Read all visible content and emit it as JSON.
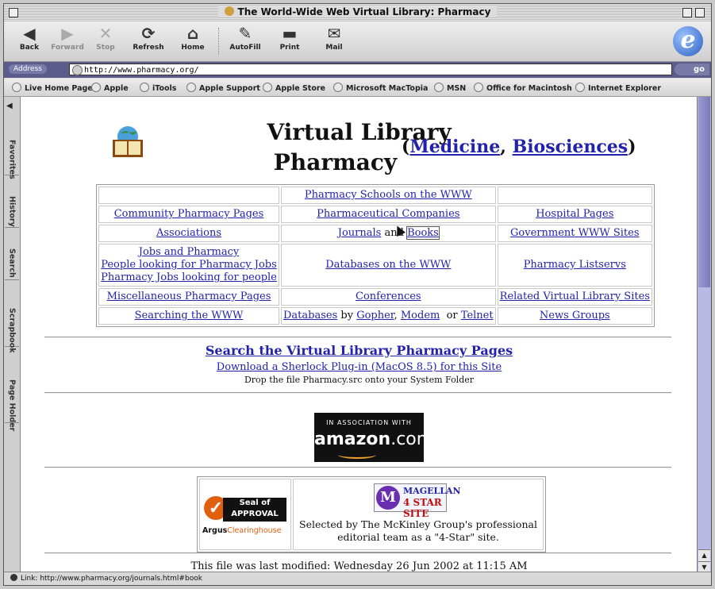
{
  "window": {
    "title": "The World-Wide Web Virtual Library: Pharmacy"
  },
  "toolbar": {
    "back": "Back",
    "forward": "Forward",
    "stop": "Stop",
    "refresh": "Refresh",
    "home": "Home",
    "autofill": "AutoFill",
    "print": "Print",
    "mail": "Mail"
  },
  "address": {
    "label": "Address",
    "url": "http://www.pharmacy.org/",
    "go": "go"
  },
  "favorites": [
    "Live Home Page",
    "Apple",
    "iTools",
    "Apple Support",
    "Apple Store",
    "Microsoft MacTopia",
    "MSN",
    "Office for Macintosh",
    "Internet Explorer"
  ],
  "sidetabs": [
    "Favorites",
    "History",
    "Search",
    "Scrapbook",
    "Page Holder"
  ],
  "page": {
    "title1": "Virtual Library",
    "title2": "Pharmacy",
    "related_open": "(",
    "related_medicine": "Medicine",
    "related_comma": ", ",
    "related_biosciences": "Biosciences",
    "related_close": ")",
    "grid": {
      "r1c2": "Pharmacy Schools on the WWW",
      "r2c1": "Community Pharmacy Pages",
      "r2c2": "Pharmaceutical Companies",
      "r2c3": "Hospital Pages",
      "r3c1": "Associations",
      "r3c2a": "Journals",
      "r3c2and": " and ",
      "r3c2b": "Books",
      "r3c3": "Government WWW Sites",
      "r4c1a": "Jobs and Pharmacy",
      "r4c1b": "People looking for Pharmacy Jobs",
      "r4c1c": "Pharmacy Jobs looking for people",
      "r4c2": "Databases on the WWW",
      "r4c3": "Pharmacy Listservs",
      "r5c1": "Miscellaneous Pharmacy Pages",
      "r5c2": "Conferences",
      "r5c3": "Related Virtual Library Sites",
      "r6c1": "Searching the WWW",
      "r6c2a": "Databases",
      "r6c2by": " by ",
      "r6c2b": "Gopher",
      "r6c2c": ", ",
      "r6c2d": "Modem",
      "r6c2or": "  or ",
      "r6c2e": "Telnet",
      "r6c3": "News Groups"
    },
    "search_heading": "Search the Virtual Library Pharmacy Pages",
    "sherlock_link": "Download a Sherlock Plug-in (MacOS 8.5) for this Site",
    "drop_text": "Drop the file Pharmacy.src onto your System Folder",
    "amazon_line1": "IN ASSOCIATION WITH",
    "amazon_brand": "amazon",
    "amazon_tld": ".com",
    "seal_line1": "Seal of",
    "seal_line2": "APPROVAL",
    "seal_argus": "Argus",
    "seal_clearinghouse": "Clearinghouse",
    "magellan_line1": "MAGELLAN",
    "magellan_line2": "4 STAR SITE",
    "magellan_text1": "Selected by The McKinley Group's professional",
    "magellan_text2": "editorial team as a \"4-Star\" site.",
    "footer": "This file was last modified: Wednesday 26 Jun 2002 at 11:15 AM"
  },
  "status": {
    "text": "Link: http://www.pharmacy.org/journals.html#book"
  }
}
